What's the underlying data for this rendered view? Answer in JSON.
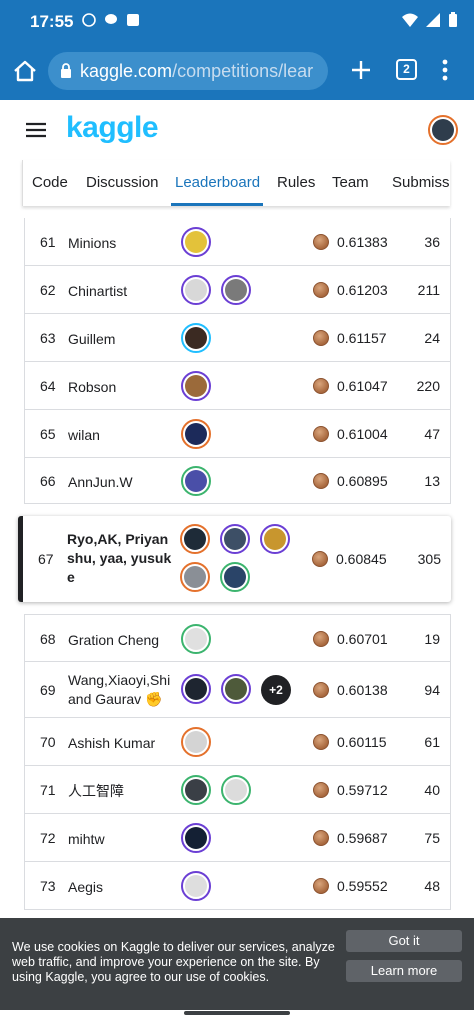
{
  "status_bar": {
    "time": "17:55"
  },
  "browser": {
    "url_host": "kaggle.com",
    "url_path": "/competitions/lear",
    "tab_count": "2"
  },
  "header": {
    "logo": "kaggle"
  },
  "tabs": [
    {
      "label": "Code"
    },
    {
      "label": "Discussion"
    },
    {
      "label": "Leaderboard",
      "active": true
    },
    {
      "label": "Rules"
    },
    {
      "label": "Team"
    },
    {
      "label": "Submissio"
    }
  ],
  "leaderboard": {
    "rows": [
      {
        "rank": "61",
        "team": "Minions",
        "score": "0.61383",
        "entries": "36"
      },
      {
        "rank": "62",
        "team": "Chinartist",
        "score": "0.61203",
        "entries": "211"
      },
      {
        "rank": "63",
        "team": "Guillem",
        "score": "0.61157",
        "entries": "24"
      },
      {
        "rank": "64",
        "team": "Robson",
        "score": "0.61047",
        "entries": "220"
      },
      {
        "rank": "65",
        "team": "wilan",
        "score": "0.61004",
        "entries": "47"
      },
      {
        "rank": "66",
        "team": "AnnJun.W",
        "score": "0.60895",
        "entries": "13"
      },
      {
        "rank": "67",
        "team_lines": [
          "Ryo,AK, Priyan",
          "shu, yaa, yusuk",
          "e"
        ],
        "score": "0.60845",
        "entries": "305",
        "highlighted": true
      },
      {
        "rank": "68",
        "team": "Gration Cheng",
        "score": "0.60701",
        "entries": "19"
      },
      {
        "rank": "69",
        "team_lines": [
          "Wang,Xiaoyi,Shi",
          "and Gaurav ✊"
        ],
        "score": "0.60138",
        "entries": "94",
        "more_members": "+2"
      },
      {
        "rank": "70",
        "team": "Ashish Kumar",
        "score": "0.60115",
        "entries": "61"
      },
      {
        "rank": "71",
        "team": "人工智障",
        "score": "0.59712",
        "entries": "40"
      },
      {
        "rank": "72",
        "team": "mihtw",
        "score": "0.59687",
        "entries": "75"
      },
      {
        "rank": "73",
        "team": "Aegis",
        "score": "0.59552",
        "entries": "48"
      }
    ]
  },
  "cookie_banner": {
    "text": "We use cookies on Kaggle to deliver our services, analyze web traffic, and improve your experience on the site. By using Kaggle, you agree to our use of cookies.",
    "accept_label": "Got it",
    "learn_label": "Learn more"
  },
  "colors": {
    "brand_blue": "#1b75bb",
    "kaggle_logo": "#20beff",
    "bronze_medal": "#a8683e",
    "cookie_bg": "#3c4043"
  }
}
